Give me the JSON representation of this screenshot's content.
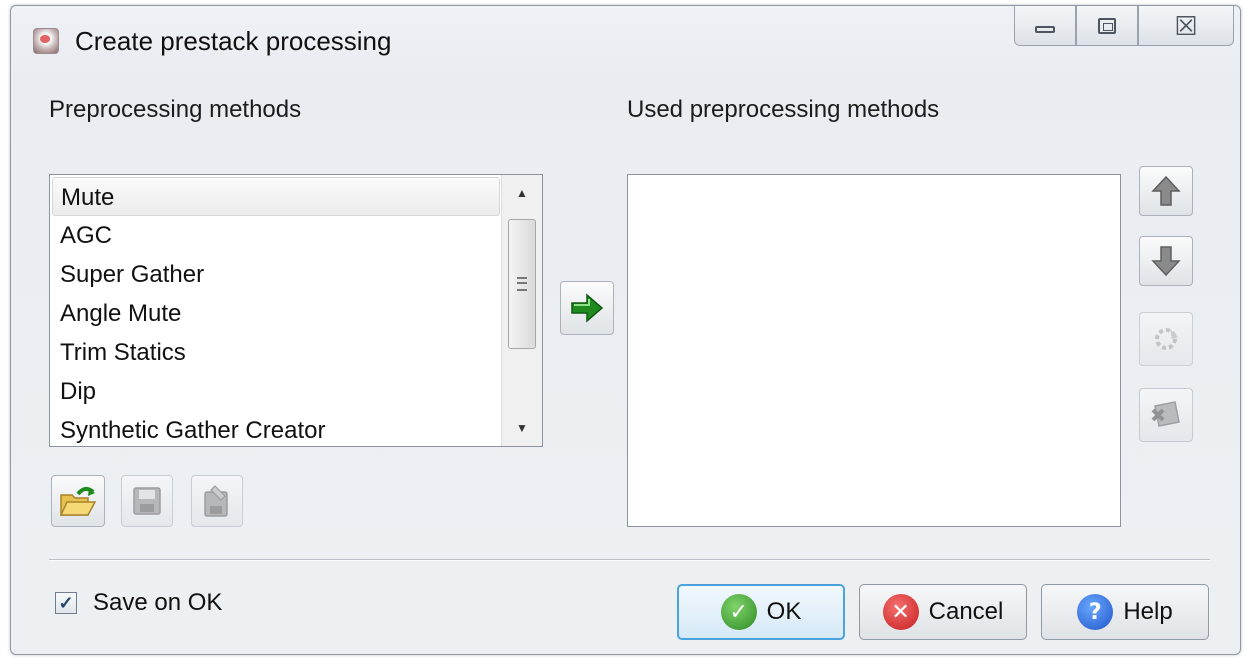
{
  "window": {
    "title": "Create prestack processing",
    "minimize_icon": "minimize-icon",
    "maximize_icon": "maximize-icon",
    "close_glyph": "☒",
    "close_icon": "close-icon"
  },
  "left_panel": {
    "heading": "Preprocessing methods",
    "methods": [
      "Mute",
      "AGC",
      "Super Gather",
      "Angle Mute",
      "Trim Statics",
      "Dip",
      "Synthetic Gather Creator"
    ],
    "selected_index": 0,
    "scroll_up_glyph": "▲",
    "scroll_down_glyph": "▼"
  },
  "right_panel": {
    "heading": "Used preprocessing methods",
    "methods": []
  },
  "icons": {
    "add": "arrow-right-icon",
    "open": "open-folder-icon",
    "save": "save-disk-icon",
    "save_as": "save-as-icon",
    "move_up": "arrow-up-icon",
    "move_down": "arrow-down-icon",
    "properties": "properties-icon",
    "remove": "remove-icon"
  },
  "footer": {
    "save_on_ok_label": "Save on OK",
    "save_on_ok_checked": true,
    "check_glyph": "✓",
    "ok_label": "OK",
    "cancel_label": "Cancel",
    "help_label": "Help",
    "ok_glyph": "✓",
    "cancel_glyph": "✕",
    "help_glyph": "?"
  },
  "colors": {
    "accent": "#4aa3df",
    "ok_green": "#2e8a25",
    "cancel_red": "#c81d1d",
    "help_blue": "#1f55c8",
    "arrow_green": "#1f8a1f"
  }
}
